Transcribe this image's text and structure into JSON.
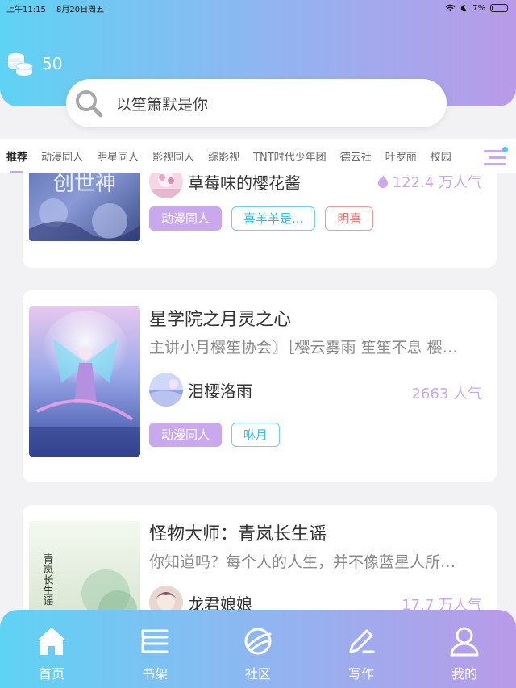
{
  "status": {
    "time": "上午11:15",
    "date": "8月20日周五",
    "battery": "7%"
  },
  "coins": {
    "count": "50"
  },
  "search": {
    "placeholder": "以笙箫默是你"
  },
  "tabs": [
    {
      "label": "推荐",
      "active": true
    },
    {
      "label": "动漫同人"
    },
    {
      "label": "明星同人"
    },
    {
      "label": "影视同人"
    },
    {
      "label": "综影视"
    },
    {
      "label": "TNT时代少年团"
    },
    {
      "label": "德云社"
    },
    {
      "label": "叶罗丽"
    },
    {
      "label": "校园"
    }
  ],
  "cards": [
    {
      "cover_text": "创世神",
      "author": "草莓味的樱花酱",
      "popularity": "122.4 万人气",
      "tags": [
        "动漫同人",
        "喜羊羊是...",
        "明喜"
      ]
    },
    {
      "title": "星学院之月灵之心",
      "desc": "主讲小月樱笙协会〗［樱云雾雨 笙笙不息 樱…",
      "author": "泪樱洛雨",
      "popularity": "2663 人气",
      "tags": [
        "动漫同人",
        "咻月"
      ]
    },
    {
      "title": "怪物大师：青岚长生谣",
      "desc": "你知道吗？每个人的人生，并不像蓝星人所…",
      "author": "龙君娘娘",
      "popularity": "17.7 万人气",
      "cover_text": "青岚长生谣"
    }
  ],
  "bottom_nav": [
    {
      "label": "首页",
      "icon": "home-icon"
    },
    {
      "label": "书架",
      "icon": "bookshelf-icon"
    },
    {
      "label": "社区",
      "icon": "planet-icon"
    },
    {
      "label": "写作",
      "icon": "pen-icon"
    },
    {
      "label": "我的",
      "icon": "user-icon"
    }
  ]
}
